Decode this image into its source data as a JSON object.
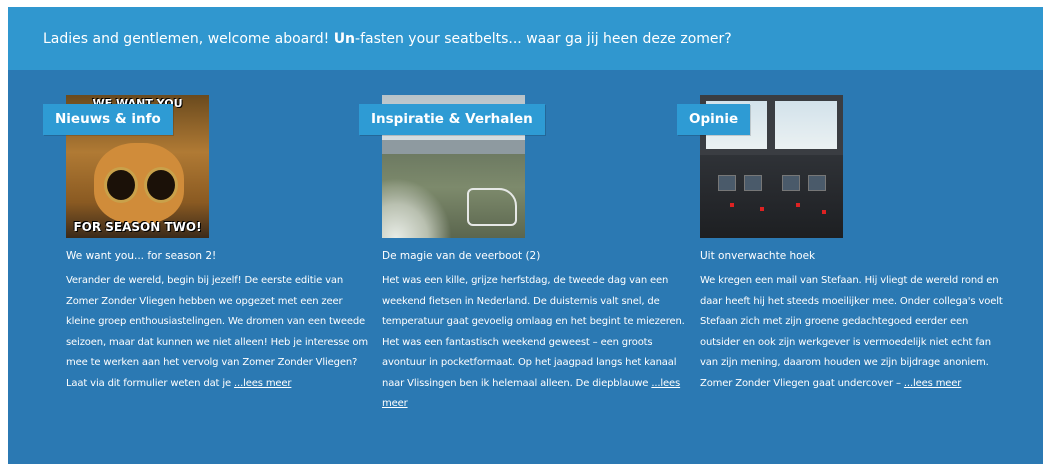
{
  "header": {
    "text_before": "Ladies and gentlemen, welcome aboard!",
    "bold": "Un",
    "text_after": "-fasten your seatbelts... waar ga jij heen deze zomer?"
  },
  "columns": [
    {
      "tag": "Nieuws & info",
      "image": {
        "caption_top": "WE WANT YOU",
        "caption_bottom": "FOR SEASON TWO!"
      },
      "title": "We want you... for season 2!",
      "body": "Verander de wereld, begin bij jezelf! De eerste editie van Zomer Zonder Vliegen hebben we opgezet met een zeer kleine groep enthousiastelingen. We dromen van een tweede seizoen, maar dat kunnen we niet alleen! Heb je interesse om mee te werken aan het vervolg van Zomer Zonder Vliegen? Laat via dit formulier weten dat je",
      "more": "...lees meer"
    },
    {
      "tag": "Inspiratie & Verhalen",
      "title": "De magie van de veerboot (2)",
      "body": "Het was een kille, grijze herfstdag, de tweede dag van een weekend fietsen in Nederland. De duisternis valt snel, de temperatuur gaat gevoelig omlaag en het begint te miezeren. Het was een fantastisch weekend geweest – een groots avontuur in pocketformaat. Op het jaagpad langs het kanaal naar Vlissingen ben ik helemaal alleen. De diepblauwe",
      "more": "...lees meer"
    },
    {
      "tag": "Opinie",
      "title": "Uit onverwachte hoek",
      "body": "We kregen een mail van Stefaan. Hij vliegt de wereld rond en daar heeft hij het steeds moeilijker mee. Onder collega's voelt Stefaan zich met zijn groene gedachtegoed eerder een outsider en ook zijn werkgever is vermoedelijk niet echt fan van zijn mening, daarom houden we zijn bijdrage anoniem. Zomer Zonder Vliegen gaat undercover –",
      "more": "...lees meer"
    }
  ],
  "colors": {
    "header_bg": "#3097cf",
    "panel_bg": "#2b79b3",
    "tag_bg": "#2e9bd4",
    "text": "#ffffff"
  }
}
